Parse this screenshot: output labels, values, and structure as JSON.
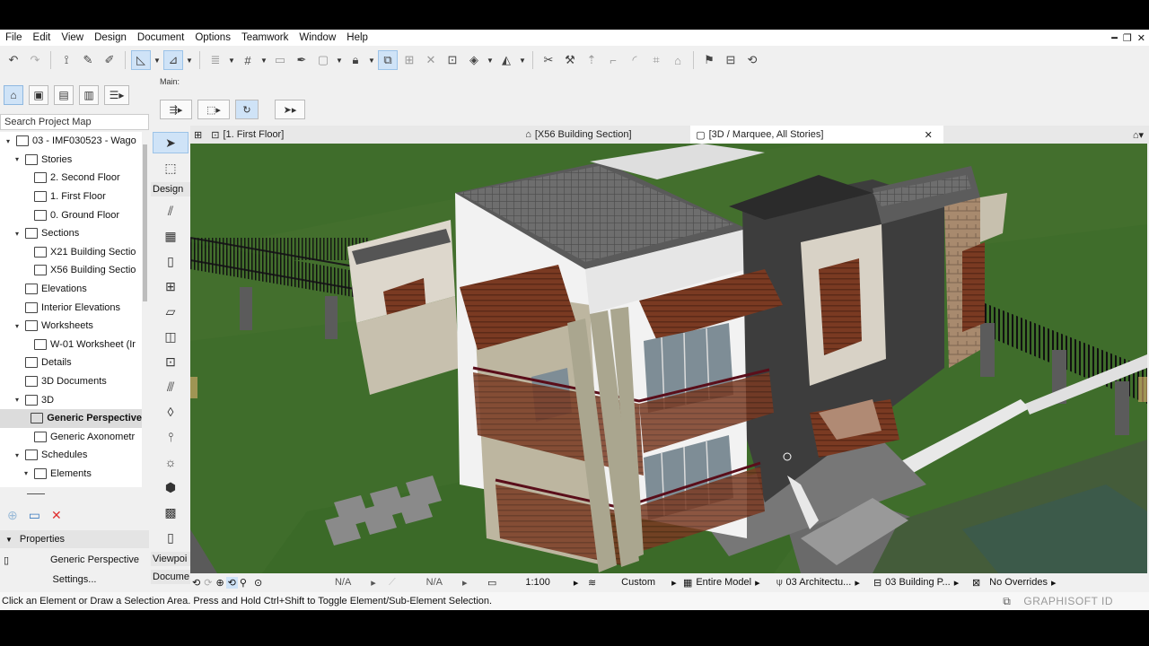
{
  "menu": [
    "File",
    "Edit",
    "View",
    "Design",
    "Document",
    "Options",
    "Teamwork",
    "Window",
    "Help"
  ],
  "infobox": {
    "label": "Main:"
  },
  "search": {
    "placeholder": "Search Project Map"
  },
  "tree": [
    {
      "label": "03 - IMF030523 - Wago",
      "indent": 0,
      "arrow": "▾",
      "sel": false
    },
    {
      "label": "Stories",
      "indent": 1,
      "arrow": "▾",
      "sel": false
    },
    {
      "label": "2. Second Floor",
      "indent": 2,
      "arrow": "",
      "sel": false
    },
    {
      "label": "1. First Floor",
      "indent": 2,
      "arrow": "",
      "sel": false
    },
    {
      "label": "0. Ground Floor",
      "indent": 2,
      "arrow": "",
      "sel": false
    },
    {
      "label": "Sections",
      "indent": 1,
      "arrow": "▾",
      "sel": false
    },
    {
      "label": "X21 Building Sectio",
      "indent": 2,
      "arrow": "",
      "sel": false
    },
    {
      "label": "X56 Building Sectio",
      "indent": 2,
      "arrow": "",
      "sel": false
    },
    {
      "label": "Elevations",
      "indent": 1,
      "arrow": "",
      "sel": false
    },
    {
      "label": "Interior Elevations",
      "indent": 1,
      "arrow": "",
      "sel": false
    },
    {
      "label": "Worksheets",
      "indent": 1,
      "arrow": "▾",
      "sel": false
    },
    {
      "label": "W-01 Worksheet (Ir",
      "indent": 2,
      "arrow": "",
      "sel": false
    },
    {
      "label": "Details",
      "indent": 1,
      "arrow": "",
      "sel": false
    },
    {
      "label": "3D Documents",
      "indent": 1,
      "arrow": "",
      "sel": false
    },
    {
      "label": "3D",
      "indent": 1,
      "arrow": "▾",
      "sel": false
    },
    {
      "label": "Generic Perspective",
      "indent": 2,
      "arrow": "",
      "sel": true
    },
    {
      "label": "Generic Axonometr",
      "indent": 2,
      "arrow": "",
      "sel": false
    },
    {
      "label": "Schedules",
      "indent": 1,
      "arrow": "▾",
      "sel": false
    },
    {
      "label": "Elements",
      "indent": 2,
      "arrow": "▾",
      "sel": false
    }
  ],
  "properties": {
    "header": "Properties",
    "name": "Generic Perspective",
    "settings": "Settings..."
  },
  "toolbox": {
    "design": "Design",
    "viewpoint": "Viewpoi",
    "document": "Docume"
  },
  "tabs": [
    {
      "label": "[1. First Floor]"
    },
    {
      "label": "[X56 Building Section]"
    },
    {
      "label": "[3D / Marquee, All Stories]",
      "close": "✕"
    }
  ],
  "status3d": {
    "na1": "N/A",
    "na2": "N/A",
    "scale": "1:100",
    "custom": "Custom",
    "model": "Entire Model",
    "arch": "03 Architectu...",
    "building": "03 Building P...",
    "overrides": "No Overrides"
  },
  "hint": "Click an Element or Draw a Selection Area. Press and Hold Ctrl+Shift to Toggle Element/Sub-Element Selection.",
  "brand": "GRAPHISOFT ID"
}
